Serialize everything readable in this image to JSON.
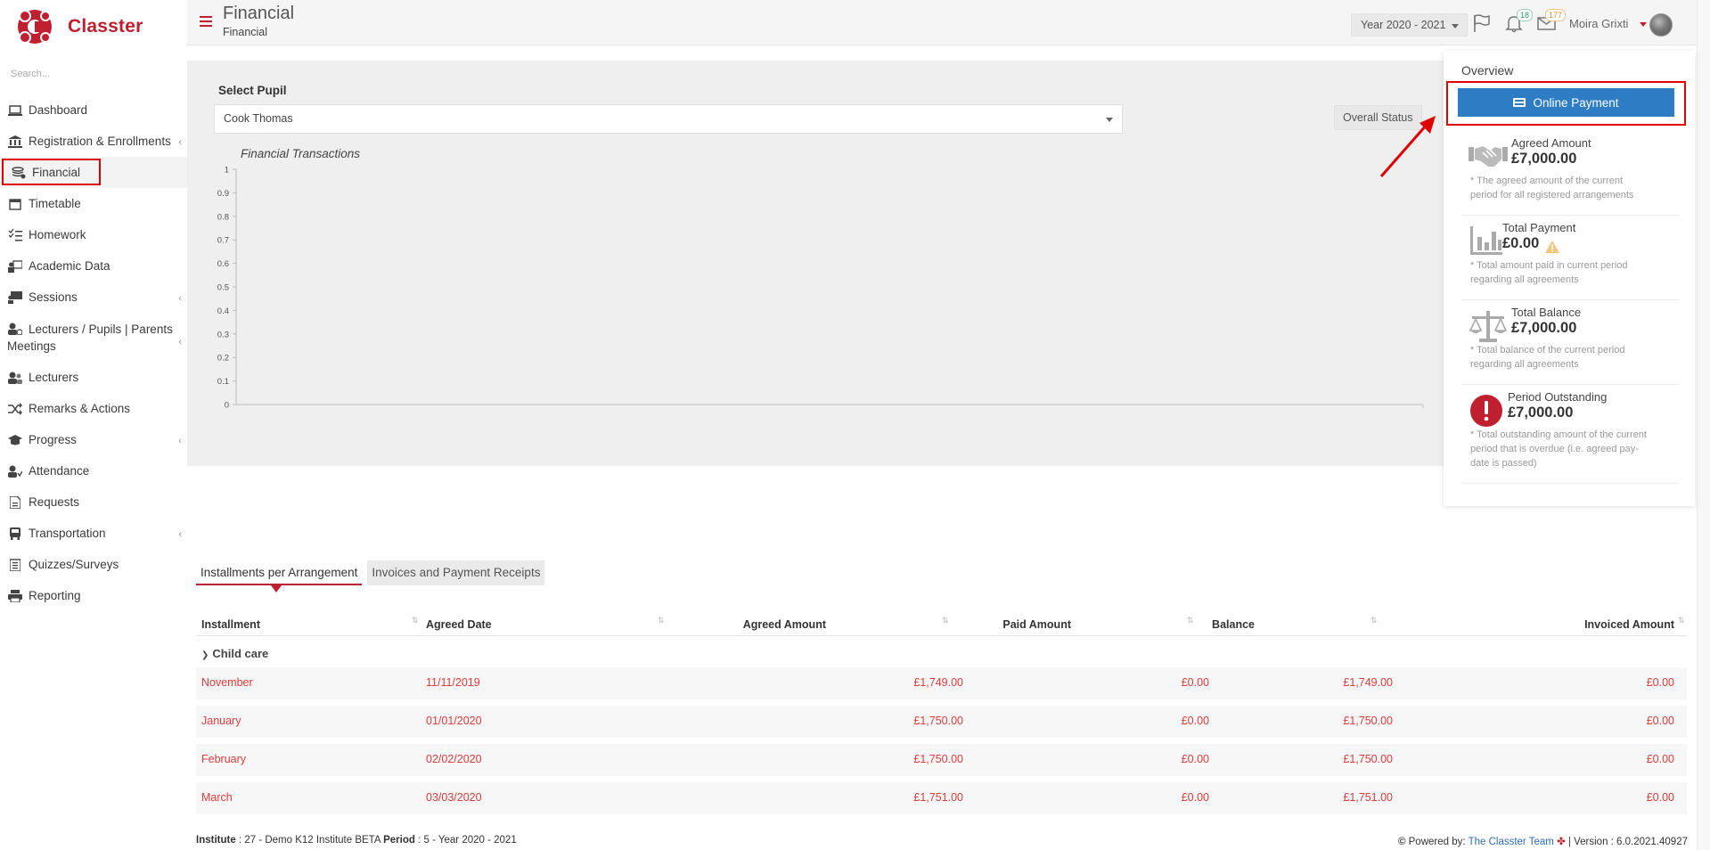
{
  "app": {
    "brand": "Classter"
  },
  "sidebar": {
    "search_placeholder": "Search...",
    "items": [
      {
        "label": "Dashboard",
        "icon": "laptop-icon"
      },
      {
        "label": "Registration & Enrollments",
        "icon": "bank-icon"
      },
      {
        "label": "Financial",
        "icon": "coins-icon"
      },
      {
        "label": "Timetable",
        "icon": "calendar-icon"
      },
      {
        "label": "Homework",
        "icon": "tasks-icon"
      },
      {
        "label": "Academic Data",
        "icon": "teacher-board-icon"
      },
      {
        "label": "Sessions",
        "icon": "presentation-icon"
      },
      {
        "label": "Lecturers / Pupils | Parents Meetings",
        "icon": "user-clock-icon"
      },
      {
        "label": "Lecturers",
        "icon": "users-icon"
      },
      {
        "label": "Remarks & Actions",
        "icon": "shuffle-icon"
      },
      {
        "label": "Progress",
        "icon": "graduation-cap-icon"
      },
      {
        "label": "Attendance",
        "icon": "user-check-icon"
      },
      {
        "label": "Requests",
        "icon": "file-icon"
      },
      {
        "label": "Transportation",
        "icon": "bus-icon"
      },
      {
        "label": "Quizzes/Surveys",
        "icon": "clipboard-list-icon"
      },
      {
        "label": "Reporting",
        "icon": "printer-icon"
      }
    ]
  },
  "header": {
    "title": "Financial",
    "subtitle": "Financial",
    "year": "Year 2020 - 2021",
    "notifications_count": "18",
    "messages_count": "177",
    "user_name": "Moira Grixti"
  },
  "main": {
    "select_label": "Select Pupil",
    "selected_pupil": "Cook Thomas",
    "overall_status_label": "Overall Status",
    "chart_title": "Financial Transactions"
  },
  "chart_data": {
    "type": "line",
    "title": "Financial Transactions",
    "ylim": [
      0,
      1
    ],
    "y_ticks": [
      "1",
      "0.9",
      "0.8",
      "0.7",
      "0.6",
      "0.5",
      "0.4",
      "0.3",
      "0.2",
      "0.1",
      "0"
    ],
    "series": []
  },
  "overview": {
    "title": "Overview",
    "online_payment_label": "Online Payment",
    "items": [
      {
        "label": "Agreed Amount",
        "value": "£7,000.00",
        "note": "* The agreed amount of the current period for all registered arrangements",
        "icon": "handshake-icon"
      },
      {
        "label": "Total Payment",
        "value": "£0.00",
        "note": "* Total amount paid in current period regarding all agreements",
        "icon": "bar-chart-icon"
      },
      {
        "label": "Total Balance",
        "value": "£7,000.00",
        "note": "* Total balance of the current period regarding all agreements",
        "icon": "balance-scale-icon"
      },
      {
        "label": "Period Outstanding",
        "value": "£7,000.00",
        "note": "* Total outstanding amount of the current period that is overdue (i.e. agreed pay-date is passed)",
        "icon": "exclamation-circle-icon"
      }
    ]
  },
  "tabs": [
    {
      "label": "Installments per Arrangement"
    },
    {
      "label": "Invoices and Payment Receipts"
    }
  ],
  "table": {
    "columns": [
      "Installment",
      "Agreed Date",
      "Agreed Amount",
      "Paid Amount",
      "Balance",
      "Invoiced Amount"
    ],
    "group": "Child care",
    "rows": [
      {
        "installment": "November",
        "date": "11/11/2019",
        "agreed": "£1,749.00",
        "paid": "£0.00",
        "balance": "£1,749.00",
        "invoiced": "£0.00"
      },
      {
        "installment": "January",
        "date": "01/01/2020",
        "agreed": "£1,750.00",
        "paid": "£0.00",
        "balance": "£1,750.00",
        "invoiced": "£0.00"
      },
      {
        "installment": "February",
        "date": "02/02/2020",
        "agreed": "£1,750.00",
        "paid": "£0.00",
        "balance": "£1,750.00",
        "invoiced": "£0.00"
      },
      {
        "installment": "March",
        "date": "03/03/2020",
        "agreed": "£1,751.00",
        "paid": "£0.00",
        "balance": "£1,751.00",
        "invoiced": "£0.00"
      }
    ]
  },
  "footer": {
    "institute_label": "Institute",
    "institute_value": ": 27 - Demo K12 Institute BETA",
    "period_label": "Period",
    "period_value": ": 5 - Year 2020 - 2021",
    "powered_by": "Powered by:",
    "team": "The Classter Team",
    "version": "| Version : 6.0.2021.40927"
  },
  "colors": {
    "brand_red": "#c01f2f",
    "button_blue": "#2e7cc4",
    "table_red": "#e03a3a",
    "annotation_red": "#e00000"
  }
}
